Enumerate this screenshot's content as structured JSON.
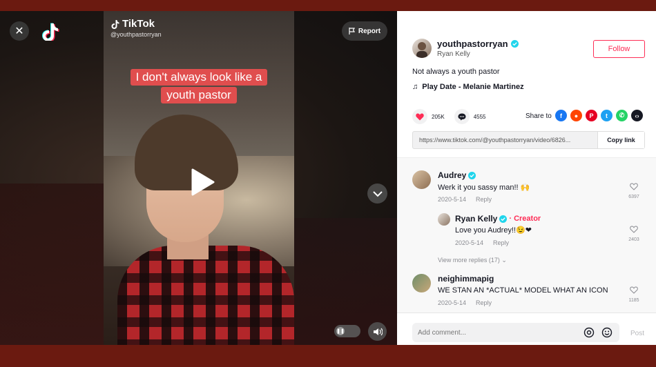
{
  "video": {
    "caption_lines": [
      "I don't always look like a",
      "youth pastor"
    ],
    "watermark_brand": "TikTok",
    "watermark_handle": "@youthpastorryan",
    "report_label": "Report",
    "close_symbol": "✕"
  },
  "author": {
    "username": "youthpastorryan",
    "nickname": "Ryan Kelly",
    "follow_label": "Follow"
  },
  "post": {
    "description": "Not always a youth pastor",
    "music": "Play Date - Melanie Martinez",
    "likes": "205K",
    "comments": "4555",
    "share_label": "Share to",
    "link": "https://www.tiktok.com/@youthpastorryan/video/6826...",
    "copy_label": "Copy link"
  },
  "comments": [
    {
      "name": "Audrey",
      "text": "Werk it you sassy man!! 🙌",
      "date": "2020-5-14",
      "reply": "Reply",
      "likes": "6397"
    },
    {
      "name": "Ryan Kelly",
      "creator": "· Creator",
      "text": "Love you Audrey!!😉❤",
      "date": "2020-5-14",
      "reply": "Reply",
      "likes": "2403"
    },
    {
      "name": "neighimmapig",
      "text": "WE STAN AN *ACTUAL* MODEL WHAT AN ICON",
      "date": "2020-5-14",
      "reply": "Reply",
      "likes": "1185"
    }
  ],
  "view_more": "View more replies (17)",
  "comment_bar": {
    "placeholder": "Add comment...",
    "post_label": "Post"
  },
  "colors": {
    "accent": "#fe2c55",
    "verified": "#20d5ec"
  }
}
